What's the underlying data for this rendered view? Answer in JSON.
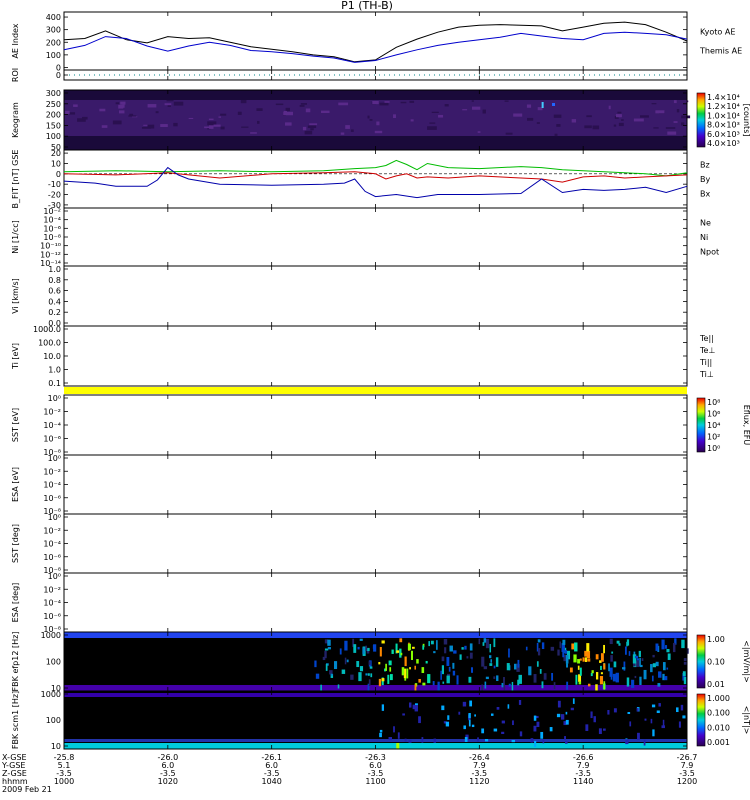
{
  "title": "P1 (TH-B)",
  "date_label": "2009 Feb 21",
  "chart_data": {
    "type": "line",
    "x_axis": {
      "row_labels": [
        "X-GSE",
        "Y-GSE",
        "Z-GSE",
        "hhmm",
        "2009 Feb 21"
      ],
      "columns": [
        [
          "-25.8",
          "5.1",
          "-3.5",
          "1000"
        ],
        [
          "-26.0",
          "6.0",
          "-3.5",
          "1020"
        ],
        [
          "-26.1",
          "6.0",
          "-3.5",
          "1040"
        ],
        [
          "-26.3",
          "6.0",
          "-3.5",
          "1100"
        ],
        [
          "-26.4",
          "7.9",
          "-3.5",
          "1120"
        ],
        [
          "-26.6",
          "7.9",
          "-3.5",
          "1140"
        ],
        [
          "-26.7",
          "7.9",
          "-3.5",
          "1200"
        ]
      ],
      "time_range": [
        0,
        120
      ]
    },
    "panels": [
      {
        "id": "ae",
        "ylabel": "AE Index",
        "yticks": [
          "400",
          "300",
          "200",
          "100",
          "0"
        ],
        "ylim": [
          -20,
          440
        ],
        "legend": [
          {
            "name": "Kyoto AE",
            "color": "#0000cc"
          },
          {
            "name": "Themis AE",
            "color": "#000000"
          }
        ],
        "series": [
          {
            "name": "Themis AE",
            "color": "#000000",
            "x": [
              0,
              4,
              8,
              12,
              16,
              20,
              24,
              28,
              32,
              36,
              40,
              44,
              48,
              52,
              56,
              60,
              64,
              68,
              72,
              76,
              80,
              84,
              88,
              92,
              96,
              100,
              104,
              108,
              112,
              116,
              120
            ],
            "y": [
              220,
              230,
              290,
              220,
              195,
              245,
              230,
              235,
              200,
              165,
              145,
              125,
              100,
              85,
              45,
              60,
              160,
              225,
              280,
              320,
              335,
              340,
              335,
              330,
              290,
              320,
              350,
              360,
              340,
              280,
              210
            ]
          },
          {
            "name": "Kyoto AE",
            "color": "#0000cc",
            "x": [
              0,
              4,
              8,
              12,
              16,
              20,
              24,
              28,
              32,
              36,
              40,
              44,
              48,
              52,
              56,
              60,
              64,
              68,
              72,
              76,
              80,
              84,
              88,
              92,
              96,
              100,
              104,
              108,
              112,
              116,
              120
            ],
            "y": [
              140,
              175,
              245,
              230,
              170,
              130,
              170,
              200,
              175,
              135,
              125,
              110,
              90,
              75,
              40,
              55,
              100,
              140,
              175,
              200,
              220,
              240,
              270,
              250,
              230,
              220,
              270,
              280,
              270,
              260,
              225
            ]
          }
        ]
      },
      {
        "id": "roi",
        "ylabel": "ROI",
        "yticks": [
          "0"
        ],
        "type": "dotted-line"
      },
      {
        "id": "keogram",
        "ylabel": "Keogram",
        "yticks": [
          "300",
          "250",
          "200",
          "150",
          "100",
          "50"
        ],
        "type": "heatmap",
        "colorbar": {
          "label": "[counts]",
          "ticks": [
            "1.4×10⁴",
            "1.2×10⁴",
            "1.0×10⁴",
            "8.0×10³",
            "6.0×10³",
            "4.0×10³"
          ]
        }
      },
      {
        "id": "bfield",
        "ylabel": "B_FIT [nT] GSE",
        "yticks": [
          "20",
          "10",
          "0",
          "-10",
          "-20",
          "-30"
        ],
        "ylim": [
          -33,
          23
        ],
        "legend": [
          {
            "name": "Bz",
            "color": "#cc0000"
          },
          {
            "name": "By",
            "color": "#00bb00"
          },
          {
            "name": "Bx",
            "color": "#0000aa"
          }
        ],
        "series": [
          {
            "name": "By",
            "color": "#00bb00",
            "x": [
              0,
              10,
              20,
              30,
              40,
              50,
              56,
              60,
              62,
              64,
              66,
              68,
              70,
              74,
              80,
              88,
              92,
              96,
              100,
              104,
              108,
              112,
              116,
              120
            ],
            "y": [
              2,
              3,
              2,
              3,
              2,
              3,
              5,
              6,
              8,
              13,
              9,
              4,
              10,
              6,
              5,
              7,
              6,
              4,
              3,
              2,
              1,
              0,
              -2,
              1
            ]
          },
          {
            "name": "Bz",
            "color": "#cc0000",
            "x": [
              0,
              10,
              20,
              30,
              40,
              50,
              56,
              60,
              62,
              64,
              66,
              68,
              70,
              74,
              80,
              88,
              92,
              96,
              100,
              104,
              108,
              112,
              116,
              120
            ],
            "y": [
              0,
              -1,
              1,
              -4,
              0,
              1,
              2,
              0,
              -5,
              -2,
              0,
              -4,
              -3,
              -4,
              -2,
              -4,
              -5,
              -8,
              -3,
              -2,
              -4,
              -3,
              -2,
              -1
            ]
          },
          {
            "name": "Bx",
            "color": "#0000aa",
            "x": [
              0,
              6,
              10,
              16,
              18,
              20,
              22,
              24,
              30,
              40,
              50,
              54,
              56,
              58,
              60,
              64,
              68,
              72,
              80,
              88,
              92,
              96,
              100,
              104,
              108,
              112,
              116,
              120
            ],
            "y": [
              -7,
              -9,
              -12,
              -12,
              -6,
              6,
              -1,
              -5,
              -10,
              -11,
              -10,
              -9,
              -5,
              -17,
              -22,
              -20,
              -23,
              -20,
              -20,
              -19,
              -5,
              -18,
              -15,
              -16,
              -15,
              -13,
              -18,
              -12
            ]
          }
        ]
      },
      {
        "id": "ni",
        "ylabel": "Ni [1/cc]",
        "yticks": [
          "10⁻²",
          "10⁻⁴",
          "10⁻⁶",
          "10⁻⁸",
          "10⁻¹⁰",
          "10⁻¹²",
          "10⁻¹⁴"
        ],
        "legend": [
          {
            "name": "Ne",
            "color": "#cc0000"
          },
          {
            "name": "Ni",
            "color": "#000000"
          },
          {
            "name": "Npot",
            "color": "#0000aa"
          }
        ]
      },
      {
        "id": "vi",
        "ylabel": "Vi [km/s]",
        "yticks": [
          "1.0",
          "0.8",
          "0.6",
          "0.4",
          "0.2",
          "0.0"
        ]
      },
      {
        "id": "ti",
        "ylabel": "Ti [eV]",
        "yticks": [
          "1000.0",
          "100.0",
          "10.0",
          "1.0",
          "0.1"
        ],
        "legend": [
          {
            "name": "Te||",
            "color": "#000000"
          },
          {
            "name": "Te⊥",
            "color": "#cc0000"
          },
          {
            "name": "Ti||",
            "color": "#00bb00"
          },
          {
            "name": "Ti⊥",
            "color": "#0000aa"
          }
        ]
      },
      {
        "id": "sst_eflux",
        "ylabel": "SST [eV]",
        "yticks": [
          "10⁰",
          "10⁻²",
          "10⁻⁴",
          "10⁻⁶",
          "10⁻⁸"
        ],
        "colorbar": {
          "label": "Eflux, EFU",
          "ticks": [
            "10⁸",
            "10⁶",
            "10⁴",
            "10²",
            "10⁰"
          ]
        }
      },
      {
        "id": "esa_eflux",
        "ylabel": "ESA [eV]",
        "yticks": [
          "10⁰",
          "10⁻²",
          "10⁻⁴",
          "10⁻⁶",
          "10⁻⁸"
        ]
      },
      {
        "id": "sst_deg",
        "ylabel": "SST [deg]",
        "yticks": [
          "10⁰",
          "10⁻²",
          "10⁻⁴",
          "10⁻⁶",
          "10⁻⁸"
        ]
      },
      {
        "id": "esa_deg",
        "ylabel": "ESA [deg]",
        "yticks": [
          "10⁰",
          "10⁻²",
          "10⁻⁴",
          "10⁻⁶",
          "10⁻⁸"
        ]
      },
      {
        "id": "fbk_e",
        "ylabel": "FBK efp12 [Hz]",
        "yticks": [
          "1000",
          "100",
          "10"
        ],
        "type": "heatmap",
        "colorbar": {
          "label": "<|mV/m|>",
          "ticks": [
            "1.00",
            "0.10",
            "0.01"
          ]
        }
      },
      {
        "id": "fbk_b",
        "ylabel": "FBK scm1 [Hz]",
        "yticks": [
          "1000",
          "100",
          "10"
        ],
        "type": "heatmap",
        "colorbar": {
          "label": "<|nT|>",
          "ticks": [
            "1.000",
            "0.100",
            "0.010",
            "0.001"
          ]
        }
      }
    ]
  }
}
